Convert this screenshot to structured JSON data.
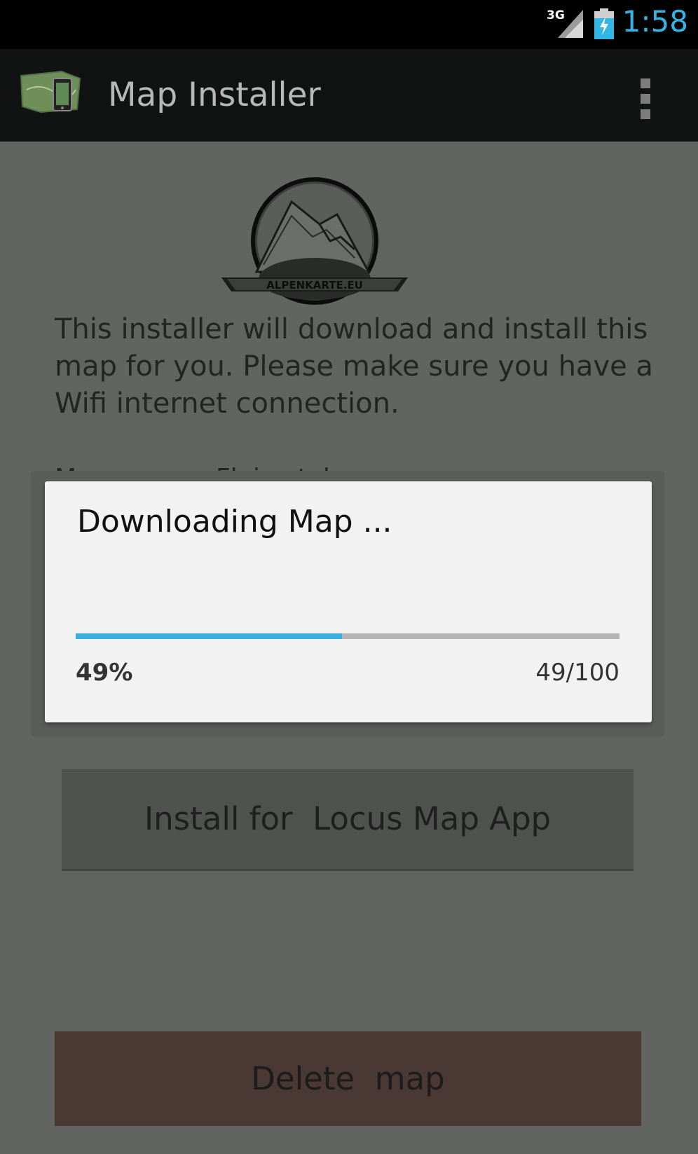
{
  "status_bar": {
    "network": "3G",
    "time": "1:58"
  },
  "action_bar": {
    "title": "Map Installer",
    "app_icon": "map-phone-icon",
    "overflow_icon": "overflow-menu-icon"
  },
  "content": {
    "logo_text": "ALPENKARTE.EU",
    "intro": "This installer will download and install this map for you. Please make sure you have a Wifi internet connection.",
    "map_label": "Map:",
    "map_value": "Fleimstaler",
    "install_button": "Install for  Locus Map App",
    "delete_button": "Delete  map"
  },
  "dialog": {
    "title": "Downloading Map ...",
    "progress": 49,
    "percent_label": "49%",
    "count_label": "49/100",
    "colors": {
      "progress_fill": "#3aaee0",
      "progress_track": "#b4b4b4"
    }
  }
}
